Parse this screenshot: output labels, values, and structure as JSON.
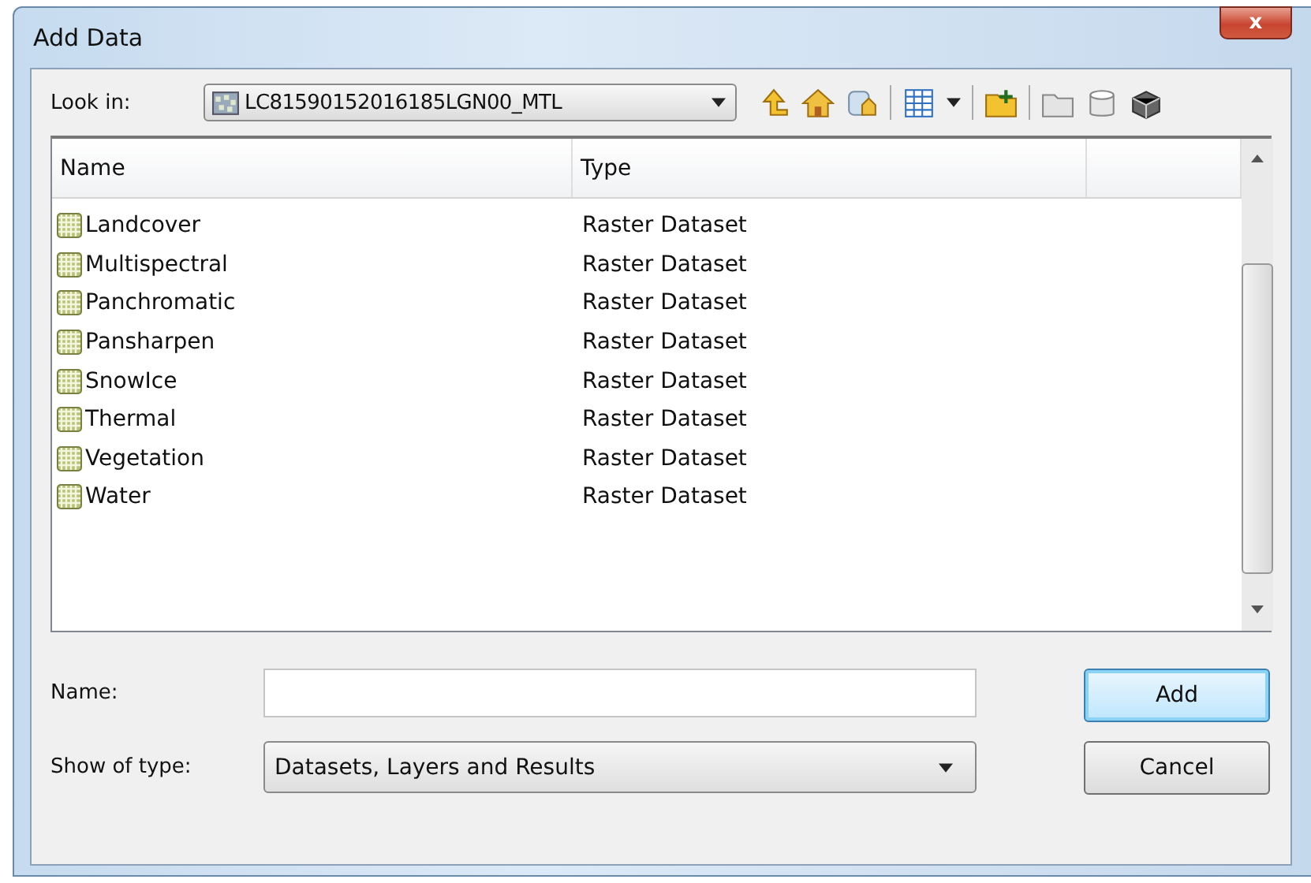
{
  "window": {
    "title": "Add Data",
    "close": "x"
  },
  "look_in": {
    "label": "Look in:",
    "value": "LC81590152016185LGN00_MTL"
  },
  "table": {
    "columns": [
      "Name",
      "Type"
    ],
    "rows": [
      {
        "name": "Landcover",
        "type": "Raster Dataset"
      },
      {
        "name": "Multispectral",
        "type": "Raster Dataset"
      },
      {
        "name": "Panchromatic",
        "type": "Raster Dataset"
      },
      {
        "name": "Pansharpen",
        "type": "Raster Dataset"
      },
      {
        "name": "SnowIce",
        "type": "Raster Dataset"
      },
      {
        "name": "Thermal",
        "type": "Raster Dataset"
      },
      {
        "name": "Vegetation",
        "type": "Raster Dataset"
      },
      {
        "name": "Water",
        "type": "Raster Dataset"
      }
    ]
  },
  "name_field": {
    "label": "Name:"
  },
  "type_field": {
    "label": "Show of type:",
    "value": "Datasets, Layers and Results"
  },
  "buttons": [
    {
      "label": "Add",
      "default": true
    },
    {
      "label": "Cancel",
      "default": false
    }
  ]
}
